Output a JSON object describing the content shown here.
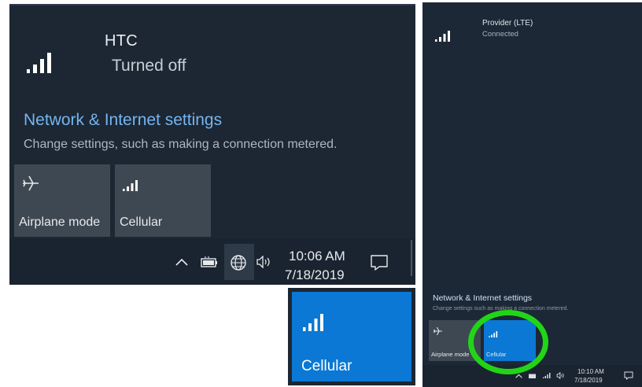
{
  "left_flyout": {
    "network": {
      "name": "HTC",
      "status": "Turned off"
    },
    "settings": {
      "link": "Network & Internet settings",
      "description": "Change settings, such as making a connection metered."
    },
    "tiles": [
      {
        "label": "Airplane mode",
        "icon": "airplane-icon",
        "active": false
      },
      {
        "label": "Cellular",
        "icon": "cellular-signal-icon",
        "active": false
      }
    ],
    "taskbar": {
      "time": "10:06 AM",
      "date": "7/18/2019",
      "icons": [
        "chevron-up-icon",
        "battery-icon",
        "globe-network-icon",
        "speaker-icon",
        "action-center-icon"
      ]
    }
  },
  "zoomed_tile": {
    "label": "Cellular",
    "icon": "cellular-signal-icon",
    "active": true
  },
  "right_flyout": {
    "network": {
      "name": "Provider (LTE)",
      "status": "Connected"
    },
    "settings": {
      "link": "Network & Internet settings",
      "description": "Change settings such as making a connection metered."
    },
    "tiles": [
      {
        "label": "Airplane mode",
        "icon": "airplane-icon",
        "active": false
      },
      {
        "label": "Cellular",
        "icon": "cellular-signal-icon",
        "active": true
      }
    ],
    "taskbar": {
      "time": "10:10 AM",
      "date": "7/18/2019"
    }
  },
  "colors": {
    "flyout_bg": "#1c2733",
    "tile_bg": "#3e4852",
    "accent_blue": "#0a78d4",
    "link_blue": "#75b4f0",
    "highlight_green": "#22d418"
  }
}
